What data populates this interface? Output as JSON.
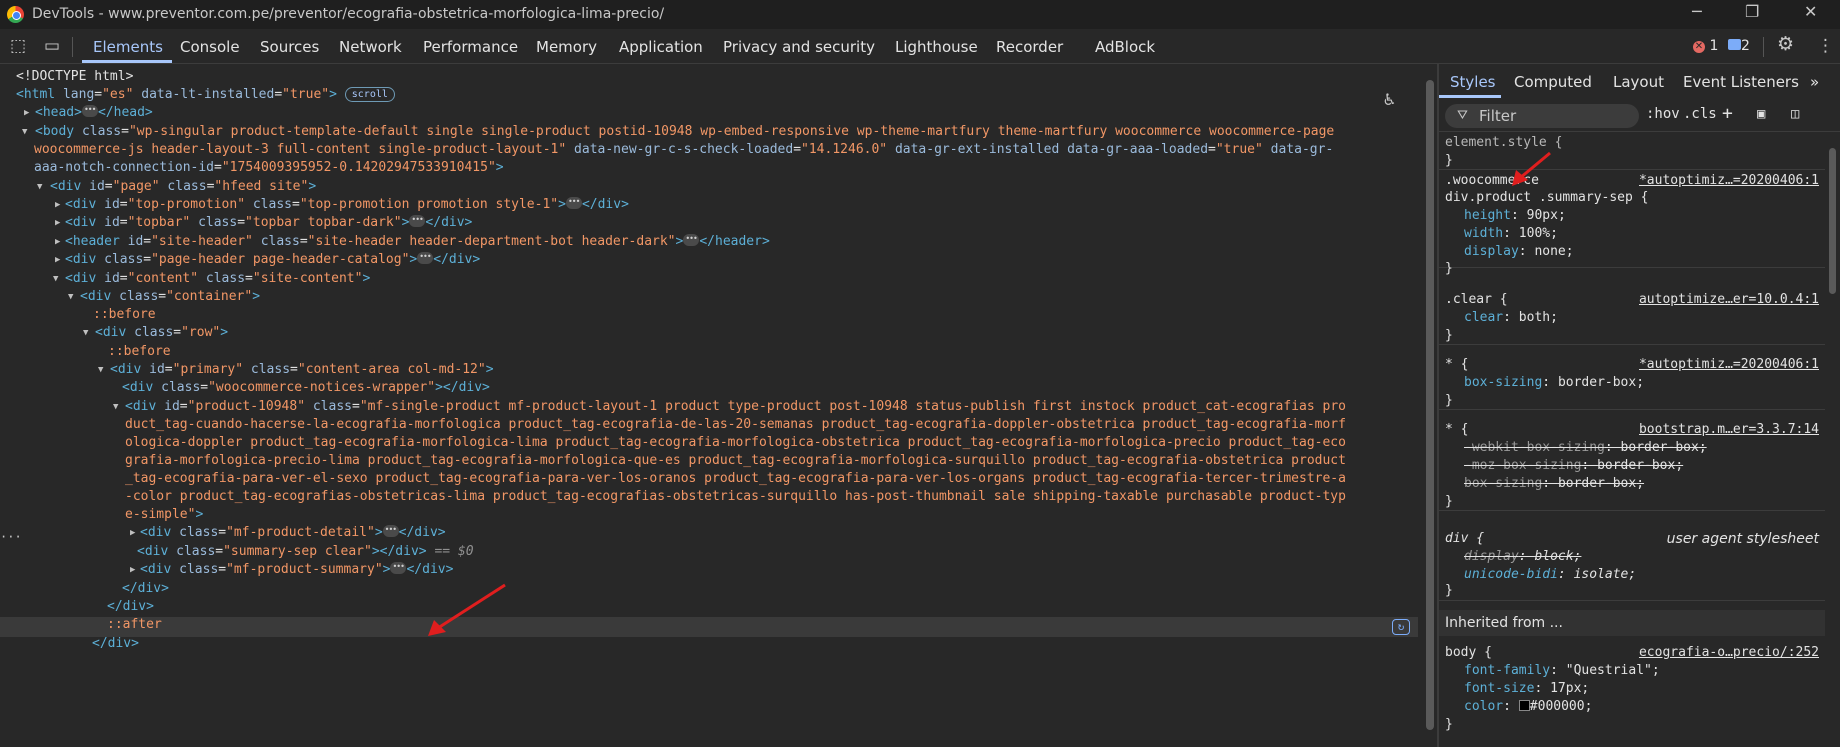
{
  "titlebar": {
    "title": "DevTools - www.preventor.com.pe/preventor/ecografia-obstetrica-morfologica-lima-precio/",
    "minimize": "─",
    "maximize": "❐",
    "close": "✕"
  },
  "toolbar": {
    "tabs": [
      "Elements",
      "Console",
      "Sources",
      "Network",
      "Performance",
      "Memory",
      "Application",
      "Privacy and security",
      "Lighthouse",
      "Recorder",
      "AdBlock"
    ],
    "errors_count": "1",
    "messages_count": "2"
  },
  "dom": {
    "doctype": "<!DOCTYPE html>",
    "html_tag": "html",
    "html_attr1": "lang",
    "html_val1": "\"es\"",
    "html_attr2": "data-lt-installed",
    "html_val2": "\"true\"",
    "scroll_badge": "scroll",
    "head": "head",
    "body_l1": "wp-singular product-template-default single single-product postid-10948 wp-embed-responsive wp-theme-martfury theme-martfury woocommerce woocommerce-page",
    "body_l2a": "woocommerce-js header-layout-3 full-content single-product-layout-1\"",
    "body_l2b": "\"14.1246.0\"",
    "body_l2c": "\"true\"",
    "body_l3": "\"1754009395952-0.14202947533910415\"",
    "div_page": "\"page\"",
    "div_page_class": "\"hfeed site\"",
    "top_promotion": "\"top-promotion\"",
    "top_promotion_class": "\"top-promotion promotion style-1\"",
    "topbar": "\"topbar\"",
    "topbar_class": "\"topbar topbar-dark\"",
    "site_header": "\"site-header\"",
    "site_header_class": "\"site-header header-department-bot header-dark\"",
    "page_header_class": "\"page-header page-header-catalog\"",
    "content": "\"content\"",
    "content_class": "\"site-content\"",
    "container": "\"container\"",
    "before": "::before",
    "after": "::after",
    "row": "\"row\"",
    "primary": "\"primary\"",
    "primary_class": "\"content-area col-md-12\"",
    "notices": "\"woocommerce-notices-wrapper\"",
    "product_id": "\"product-10948\"",
    "prod_l1": "\"mf-single-product mf-product-layout-1 product type-product post-10948 status-publish first instock product_cat-ecografias pro",
    "prod_l2": "duct_tag-cuando-hacerse-la-ecografia-morfologica product_tag-ecografia-de-las-20-semanas product_tag-ecografia-doppler-obstetrica product_tag-ecografia-morf",
    "prod_l3": "ologica-doppler product_tag-ecografia-morfologica-lima product_tag-ecografia-morfologica-obstetrica product_tag-ecografia-morfologica-precio product_tag-eco",
    "prod_l4": "grafia-morfologica-precio-lima product_tag-ecografia-morfologica-que-es product_tag-ecografia-morfologica-surquillo product_tag-ecografia-obstetrica product",
    "prod_l5": "_tag-ecografia-para-ver-el-sexo product_tag-ecografia-para-ver-los-oranos product_tag-ecografia-para-ver-los-organs product_tag-ecografia-tercer-trimestre-a",
    "prod_l6": "-color product_tag-ecografias-obstetricas-lima product_tag-ecografias-obstetricas-surquillo has-post-thumbnail sale shipping-taxable purchasable product-typ",
    "prod_l7": "e-simple\"",
    "detail_class": "\"mf-product-detail\"",
    "sep_class": "\"summary-sep clear\"",
    "sel_marker": "== $0",
    "summary_class": "\"mf-product-summary\""
  },
  "styles": {
    "tabs": [
      "Styles",
      "Computed",
      "Layout",
      "Event Listeners"
    ],
    "filter_placeholder": "Filter",
    "hov": ":hov",
    "cls": ".cls",
    "element_style": "element.style {",
    "r1_sel1": ".woocommerce",
    "r1_sel2": "div.product .summary-sep {",
    "r1_src": "*autoptimiz…=20200406:1",
    "r1_p1": "height",
    "r1_v1": "90px",
    "r1_p2": "width",
    "r1_v2": "100%",
    "r1_p3": "display",
    "r1_v3": "none",
    "r2_sel": ".clear {",
    "r2_src": "autoptimize…er=10.0.4:1",
    "r2_p1": "clear",
    "r2_v1": "both",
    "r3_sel": "* {",
    "r3_src": "*autoptimiz…=20200406:1",
    "r3_p1": "box-sizing",
    "r3_v1": "border-box",
    "r4_sel": "* {",
    "r4_src": "bootstrap.m…er=3.3.7:14",
    "r4_p1": "-webkit-box-sizing",
    "r4_v1": "border-box",
    "r4_p2": "-moz-box-sizing",
    "r4_v2": "border-box",
    "r4_p3": "box-sizing",
    "r4_v3": "border-box",
    "r5_sel": "div {",
    "r5_src": "user agent stylesheet",
    "r5_p1": "display",
    "r5_v1": "block",
    "r5_p2": "unicode-bidi",
    "r5_v2": "isolate",
    "inherited": "Inherited from ...",
    "r6_sel": "body {",
    "r6_src": "ecografia-o…precio/:252",
    "r6_p1": "font-family",
    "r6_v1": "\"Questrial\"",
    "r6_p2": "font-size",
    "r6_v2": "17px",
    "r6_p3": "color",
    "r6_v3": "#000000"
  },
  "colors": {
    "accent": "#a8c7fa",
    "tag": "#5db0d7",
    "attr_value": "#f29766",
    "annotation_arrow": "#e01e1e"
  }
}
